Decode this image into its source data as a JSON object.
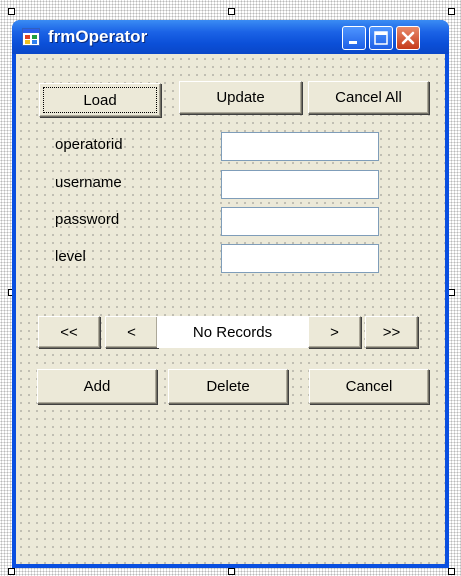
{
  "window": {
    "title": "frmOperator"
  },
  "toolbar": {
    "load": "Load",
    "update": "Update",
    "cancel_all": "Cancel All"
  },
  "fields": [
    {
      "label": "operatorid",
      "value": ""
    },
    {
      "label": "username",
      "value": ""
    },
    {
      "label": "password",
      "value": ""
    },
    {
      "label": "level",
      "value": ""
    }
  ],
  "navigator": {
    "first": "<<",
    "prev": "<",
    "status": "No Records",
    "next": ">",
    "last": ">>"
  },
  "actions": {
    "add": "Add",
    "delete": "Delete",
    "cancel": "Cancel"
  },
  "icons": {
    "app": "form-icon",
    "minimize": "minimize-icon",
    "maximize": "maximize-icon",
    "close": "close-icon"
  },
  "colors": {
    "titlebar": "#0a4fe0",
    "client": "#ece9d8",
    "close_button": "#c63a1a"
  }
}
